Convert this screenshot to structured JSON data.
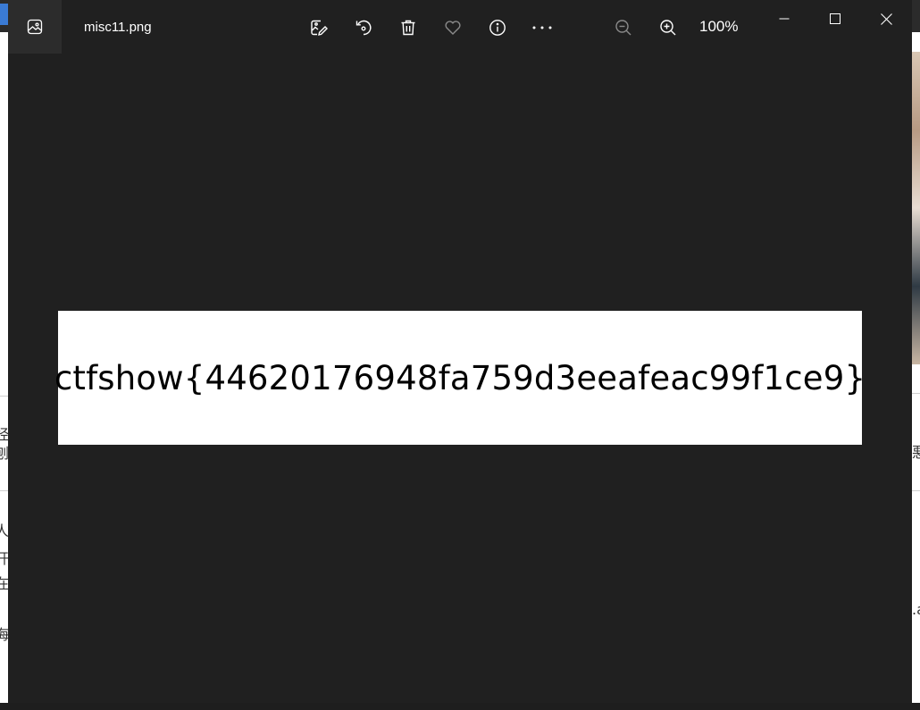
{
  "window": {
    "filename": "misc11.png",
    "zoom_level": "100%"
  },
  "toolbar": {
    "items": [
      {
        "name": "edit-image",
        "icon": "edit-image-icon"
      },
      {
        "name": "rotate",
        "icon": "rotate-icon"
      },
      {
        "name": "delete",
        "icon": "trash-icon"
      },
      {
        "name": "favorite",
        "icon": "heart-icon"
      },
      {
        "name": "info",
        "icon": "info-icon"
      },
      {
        "name": "more",
        "icon": "more-icon"
      }
    ]
  },
  "image": {
    "text": "ctfshow{44620176948fa759d3eeafeac99f1ce9}"
  },
  "background": {
    "left_fragments": [
      "经",
      "刨",
      "人",
      "开",
      "在",
      "，",
      "海"
    ],
    "right_fragments": [
      "悪",
      ".a"
    ]
  },
  "colors": {
    "window_bg": "#202020",
    "titlebar_icon_box": "#2c2c2c",
    "text": "#ffffff",
    "image_bg": "#ffffff"
  }
}
